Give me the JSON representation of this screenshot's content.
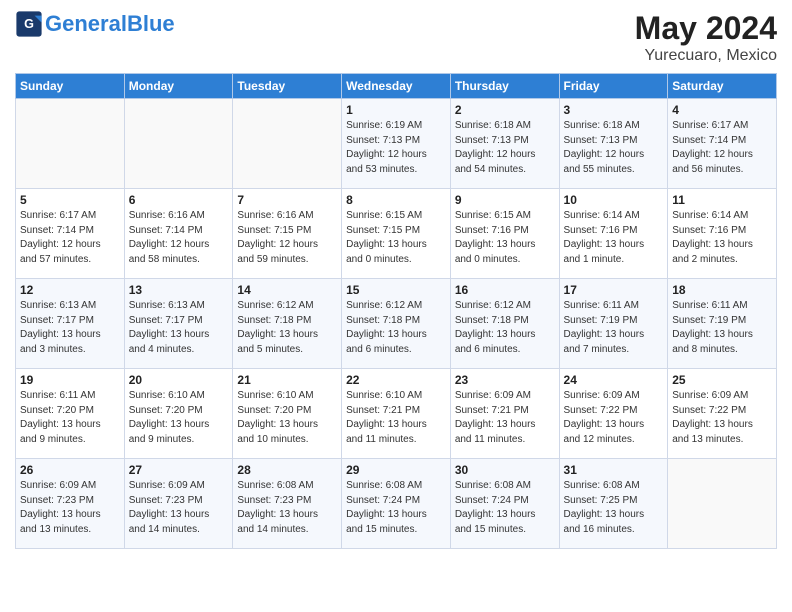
{
  "header": {
    "logo_line1": "General",
    "logo_line2": "Blue",
    "month_year": "May 2024",
    "location": "Yurecuaro, Mexico"
  },
  "days_of_week": [
    "Sunday",
    "Monday",
    "Tuesday",
    "Wednesday",
    "Thursday",
    "Friday",
    "Saturday"
  ],
  "weeks": [
    [
      {
        "day": "",
        "info": ""
      },
      {
        "day": "",
        "info": ""
      },
      {
        "day": "",
        "info": ""
      },
      {
        "day": "1",
        "info": "Sunrise: 6:19 AM\nSunset: 7:13 PM\nDaylight: 12 hours\nand 53 minutes."
      },
      {
        "day": "2",
        "info": "Sunrise: 6:18 AM\nSunset: 7:13 PM\nDaylight: 12 hours\nand 54 minutes."
      },
      {
        "day": "3",
        "info": "Sunrise: 6:18 AM\nSunset: 7:13 PM\nDaylight: 12 hours\nand 55 minutes."
      },
      {
        "day": "4",
        "info": "Sunrise: 6:17 AM\nSunset: 7:14 PM\nDaylight: 12 hours\nand 56 minutes."
      }
    ],
    [
      {
        "day": "5",
        "info": "Sunrise: 6:17 AM\nSunset: 7:14 PM\nDaylight: 12 hours\nand 57 minutes."
      },
      {
        "day": "6",
        "info": "Sunrise: 6:16 AM\nSunset: 7:14 PM\nDaylight: 12 hours\nand 58 minutes."
      },
      {
        "day": "7",
        "info": "Sunrise: 6:16 AM\nSunset: 7:15 PM\nDaylight: 12 hours\nand 59 minutes."
      },
      {
        "day": "8",
        "info": "Sunrise: 6:15 AM\nSunset: 7:15 PM\nDaylight: 13 hours\nand 0 minutes."
      },
      {
        "day": "9",
        "info": "Sunrise: 6:15 AM\nSunset: 7:16 PM\nDaylight: 13 hours\nand 0 minutes."
      },
      {
        "day": "10",
        "info": "Sunrise: 6:14 AM\nSunset: 7:16 PM\nDaylight: 13 hours\nand 1 minute."
      },
      {
        "day": "11",
        "info": "Sunrise: 6:14 AM\nSunset: 7:16 PM\nDaylight: 13 hours\nand 2 minutes."
      }
    ],
    [
      {
        "day": "12",
        "info": "Sunrise: 6:13 AM\nSunset: 7:17 PM\nDaylight: 13 hours\nand 3 minutes."
      },
      {
        "day": "13",
        "info": "Sunrise: 6:13 AM\nSunset: 7:17 PM\nDaylight: 13 hours\nand 4 minutes."
      },
      {
        "day": "14",
        "info": "Sunrise: 6:12 AM\nSunset: 7:18 PM\nDaylight: 13 hours\nand 5 minutes."
      },
      {
        "day": "15",
        "info": "Sunrise: 6:12 AM\nSunset: 7:18 PM\nDaylight: 13 hours\nand 6 minutes."
      },
      {
        "day": "16",
        "info": "Sunrise: 6:12 AM\nSunset: 7:18 PM\nDaylight: 13 hours\nand 6 minutes."
      },
      {
        "day": "17",
        "info": "Sunrise: 6:11 AM\nSunset: 7:19 PM\nDaylight: 13 hours\nand 7 minutes."
      },
      {
        "day": "18",
        "info": "Sunrise: 6:11 AM\nSunset: 7:19 PM\nDaylight: 13 hours\nand 8 minutes."
      }
    ],
    [
      {
        "day": "19",
        "info": "Sunrise: 6:11 AM\nSunset: 7:20 PM\nDaylight: 13 hours\nand 9 minutes."
      },
      {
        "day": "20",
        "info": "Sunrise: 6:10 AM\nSunset: 7:20 PM\nDaylight: 13 hours\nand 9 minutes."
      },
      {
        "day": "21",
        "info": "Sunrise: 6:10 AM\nSunset: 7:20 PM\nDaylight: 13 hours\nand 10 minutes."
      },
      {
        "day": "22",
        "info": "Sunrise: 6:10 AM\nSunset: 7:21 PM\nDaylight: 13 hours\nand 11 minutes."
      },
      {
        "day": "23",
        "info": "Sunrise: 6:09 AM\nSunset: 7:21 PM\nDaylight: 13 hours\nand 11 minutes."
      },
      {
        "day": "24",
        "info": "Sunrise: 6:09 AM\nSunset: 7:22 PM\nDaylight: 13 hours\nand 12 minutes."
      },
      {
        "day": "25",
        "info": "Sunrise: 6:09 AM\nSunset: 7:22 PM\nDaylight: 13 hours\nand 13 minutes."
      }
    ],
    [
      {
        "day": "26",
        "info": "Sunrise: 6:09 AM\nSunset: 7:23 PM\nDaylight: 13 hours\nand 13 minutes."
      },
      {
        "day": "27",
        "info": "Sunrise: 6:09 AM\nSunset: 7:23 PM\nDaylight: 13 hours\nand 14 minutes."
      },
      {
        "day": "28",
        "info": "Sunrise: 6:08 AM\nSunset: 7:23 PM\nDaylight: 13 hours\nand 14 minutes."
      },
      {
        "day": "29",
        "info": "Sunrise: 6:08 AM\nSunset: 7:24 PM\nDaylight: 13 hours\nand 15 minutes."
      },
      {
        "day": "30",
        "info": "Sunrise: 6:08 AM\nSunset: 7:24 PM\nDaylight: 13 hours\nand 15 minutes."
      },
      {
        "day": "31",
        "info": "Sunrise: 6:08 AM\nSunset: 7:25 PM\nDaylight: 13 hours\nand 16 minutes."
      },
      {
        "day": "",
        "info": ""
      }
    ]
  ]
}
